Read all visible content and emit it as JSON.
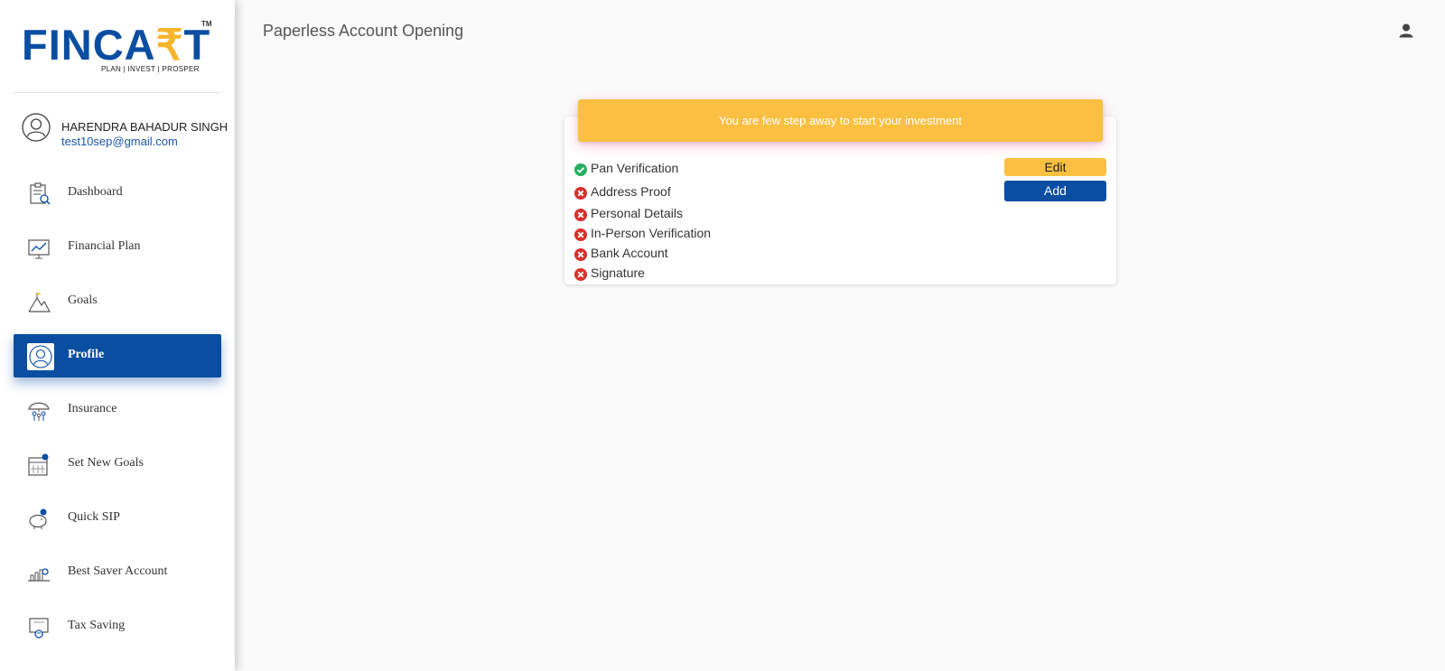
{
  "brand": {
    "logo_main": "FINCA",
    "logo_symbol": "₹",
    "logo_end": "T",
    "logo_tm": "TM",
    "tagline": "PLAN | INVEST | PROSPER",
    "primary_color": "#0a4ea2",
    "accent_color": "#fbc042"
  },
  "user": {
    "name": "HARENDRA BAHADUR SINGH",
    "email": "test10sep@gmail.com"
  },
  "sidebar": {
    "items": [
      {
        "label": "Dashboard",
        "icon": "dashboard-icon",
        "active": false
      },
      {
        "label": "Financial Plan",
        "icon": "chart-icon",
        "active": false
      },
      {
        "label": "Goals",
        "icon": "mountain-flag-icon",
        "active": false
      },
      {
        "label": "Profile",
        "icon": "user-icon",
        "active": true
      },
      {
        "label": "Insurance",
        "icon": "umbrella-family-icon",
        "active": false
      },
      {
        "label": "Set New Goals",
        "icon": "calendar-icon",
        "active": false
      },
      {
        "label": "Quick SIP",
        "icon": "piggy-bank-icon",
        "active": false
      },
      {
        "label": "Best Saver Account",
        "icon": "growth-icon",
        "active": false
      },
      {
        "label": "Tax Saving",
        "icon": "tax-icon",
        "active": false
      }
    ]
  },
  "header": {
    "title": "Paperless Account Opening",
    "user_menu_icon": "person-icon"
  },
  "onboarding": {
    "banner_text": "You are few step away to start your investment",
    "steps": [
      {
        "label": "Pan Verification",
        "status": "done"
      },
      {
        "label": "Address Proof",
        "status": "pending"
      },
      {
        "label": "Personal Details",
        "status": "pending"
      },
      {
        "label": "In-Person Verification",
        "status": "pending"
      },
      {
        "label": "Bank Account",
        "status": "pending"
      },
      {
        "label": "Signature",
        "status": "pending"
      }
    ],
    "edit_label": "Edit",
    "add_label": "Add",
    "done_color": "#27ae60",
    "pending_color": "#d9302c"
  }
}
